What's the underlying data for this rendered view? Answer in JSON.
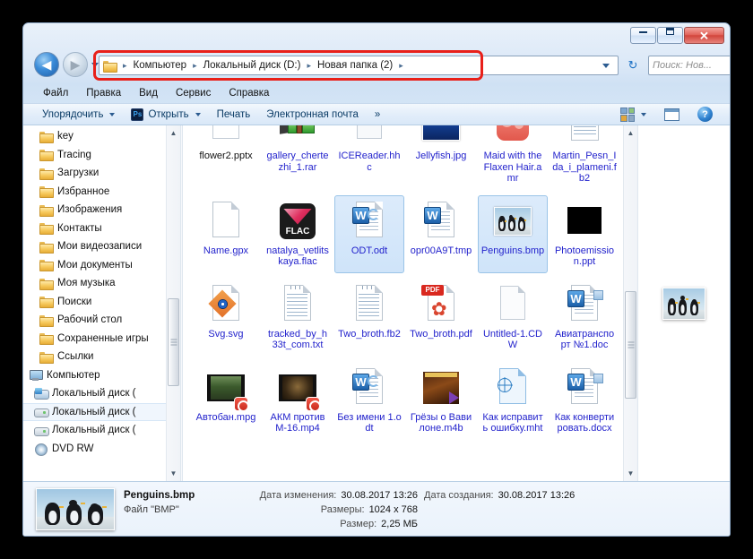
{
  "window": {
    "buttons": {
      "minimize": "minimize-button",
      "maximize": "maximize-button",
      "close": "✕"
    }
  },
  "nav": {
    "back_glyph": "◀",
    "forward_glyph": "▶",
    "breadcrumbs": [
      "Компьютер",
      "Локальный диск (D:)",
      "Новая папка (2)"
    ],
    "separator": "▸",
    "refresh_glyph": "↻"
  },
  "search": {
    "placeholder": "Поиск: Нов...",
    "value": "",
    "icon": "search-icon"
  },
  "menubar": {
    "items": [
      "Файл",
      "Правка",
      "Вид",
      "Сервис",
      "Справка"
    ]
  },
  "toolbar": {
    "organize": "Упорядочить",
    "open": "Открыть",
    "open_app_badge": "Ps",
    "print": "Печать",
    "email": "Электронная почта",
    "overflow": "»",
    "view_icon": "view-options-icon",
    "preview_pane_icon": "preview-pane-icon",
    "help_icon": "help-icon"
  },
  "sidebar": {
    "items": [
      {
        "label": "key",
        "icon": "folder-icon",
        "level": "child"
      },
      {
        "label": "Tracing",
        "icon": "folder-icon",
        "level": "child"
      },
      {
        "label": "Загрузки",
        "icon": "downloads-folder-icon",
        "level": "child"
      },
      {
        "label": "Избранное",
        "icon": "favorites-folder-icon",
        "level": "child"
      },
      {
        "label": "Изображения",
        "icon": "pictures-folder-icon",
        "level": "child"
      },
      {
        "label": "Контакты",
        "icon": "contacts-folder-icon",
        "level": "child"
      },
      {
        "label": "Мои видеозаписи",
        "icon": "videos-folder-icon",
        "level": "child"
      },
      {
        "label": "Мои документы",
        "icon": "documents-folder-icon",
        "level": "child"
      },
      {
        "label": "Моя музыка",
        "icon": "music-folder-icon",
        "level": "child"
      },
      {
        "label": "Поиски",
        "icon": "searches-folder-icon",
        "level": "child"
      },
      {
        "label": "Рабочий стол",
        "icon": "desktop-folder-icon",
        "level": "child"
      },
      {
        "label": "Сохраненные игры",
        "icon": "saved-games-folder-icon",
        "level": "child"
      },
      {
        "label": "Ссылки",
        "icon": "links-folder-icon",
        "level": "child"
      },
      {
        "label": "Компьютер",
        "icon": "computer-icon",
        "level": "root"
      },
      {
        "label": "Локальный диск (",
        "icon": "system-drive-icon",
        "level": "drive"
      },
      {
        "label": "Локальный диск (",
        "icon": "drive-icon",
        "level": "drive",
        "selected": true
      },
      {
        "label": "Локальный диск (",
        "icon": "drive-icon",
        "level": "drive"
      },
      {
        "label": "DVD RW",
        "icon": "dvd-drive-icon",
        "level": "drive"
      }
    ]
  },
  "files": [
    {
      "name": "flower2.pptx",
      "icon": "powerpoint-file-icon",
      "label_color": "dark"
    },
    {
      "name": "gallery_chertezhi_1.rar",
      "icon": "rar-archive-icon"
    },
    {
      "name": "ICEReader.hhc",
      "icon": "hhc-file-icon"
    },
    {
      "name": "Jellyfish.jpg",
      "icon": "jpeg-image-icon"
    },
    {
      "name": "Maid with the Flaxen Hair.amr",
      "icon": "amr-audio-icon"
    },
    {
      "name": "Martin_Pesn_Ida_i_plameni.fb2",
      "icon": "fb2-book-icon"
    },
    {
      "name": "Name.gpx",
      "icon": "generic-file-icon"
    },
    {
      "name": "natalya_vetlitskaya.flac",
      "icon": "flac-audio-icon"
    },
    {
      "name": "ODT.odt",
      "icon": "odt-document-icon",
      "selected": true
    },
    {
      "name": "opr00A9T.tmp",
      "icon": "word-tmp-icon"
    },
    {
      "name": "Penguins.bmp",
      "icon": "bmp-image-icon",
      "selected": true
    },
    {
      "name": "Photoemission.ppt",
      "icon": "ppt-black-icon"
    },
    {
      "name": "Svg.svg",
      "icon": "svg-image-icon"
    },
    {
      "name": "tracked_by_h33t_com.txt",
      "icon": "text-file-icon"
    },
    {
      "name": "Two_broth.fb2",
      "icon": "text-file-icon"
    },
    {
      "name": "Two_broth.pdf",
      "icon": "pdf-file-icon"
    },
    {
      "name": "Untitled-1.CDW",
      "icon": "cdw-file-icon"
    },
    {
      "name": "Авиатранспорт №1.doc",
      "icon": "word-document-icon"
    },
    {
      "name": "Автобан.mpg",
      "icon": "mpg-video-icon"
    },
    {
      "name": "АКМ против М-16.mp4",
      "icon": "mp4-video-icon"
    },
    {
      "name": "Без имени 1.odt",
      "icon": "odt-document-icon"
    },
    {
      "name": "Грёзы о Вавилоне.m4b",
      "icon": "m4b-audiobook-icon"
    },
    {
      "name": "Как исправить ошибку.mht",
      "icon": "mht-file-icon"
    },
    {
      "name": "Как конвертировать.docx",
      "icon": "word-document-icon"
    }
  ],
  "details": {
    "file_name": "Penguins.bmp",
    "file_type": "Файл \"BMP\"",
    "modified_label": "Дата изменения:",
    "modified_value": "30.08.2017 13:26",
    "dimensions_label": "Размеры:",
    "dimensions_value": "1024 x 768",
    "size_label": "Размер:",
    "size_value": "2,25 МБ",
    "created_label": "Дата создания:",
    "created_value": "30.08.2017 13:26"
  },
  "colors": {
    "highlight_box": "#e8201a",
    "file_label": "#2222cc",
    "selection_bg": "#cfe4f9"
  }
}
